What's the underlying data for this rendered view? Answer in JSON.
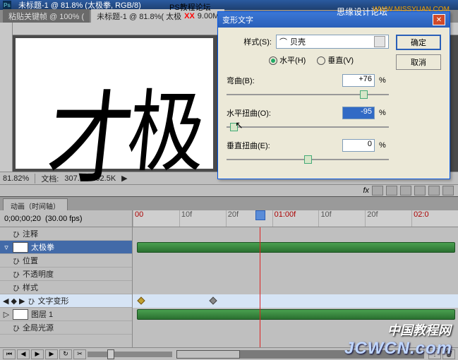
{
  "titlebar": {
    "doc": "未标题-1 @ 81.8% (太极拳, RGB/8)"
  },
  "tabs": {
    "t1": "粘贴关键帧 @ 100% (",
    "t2": "未标题-1 @ 81.8%( 太极",
    "t2_suffix": "9.00M"
  },
  "watermark": {
    "line1": "PS教程论坛",
    "xx": "XX",
    "forum": "思缘设计论坛",
    "url": "WWW.MISSYUAN.COM",
    "cn": "中国教程网",
    "jcw": "JCWCN.com"
  },
  "canvas": {
    "char1": "才",
    "char2": "极"
  },
  "status": {
    "zoom": "81.82%",
    "doc_label": "文档:",
    "doc_size": "307.6K/102.5K"
  },
  "dialog": {
    "title": "变形文字",
    "style_label": "样式(S):",
    "style_value": "贝壳",
    "style_icon": "⌒",
    "horiz": "水平(H)",
    "vert": "垂直(V)",
    "bend_label": "弯曲(B):",
    "bend_value": "+76",
    "hdist_label": "水平扭曲(O):",
    "hdist_value": "-95",
    "vdist_label": "垂直扭曲(E):",
    "vdist_value": "0",
    "pct": "%",
    "ok": "确定",
    "cancel": "取消"
  },
  "timeline": {
    "tab": "动画（时间轴）",
    "time": "0;00;00;20",
    "fps": "(30.00 fps)",
    "ticks": [
      "00",
      "10f",
      "20f",
      "01:00f",
      "10f",
      "20f",
      "02:0"
    ],
    "rows": {
      "comments": "注释",
      "layer": "太极拳",
      "position": "位置",
      "opacity": "不透明度",
      "style": "样式",
      "textwarp": "文字变形",
      "layer1": "图层 1",
      "globallight": "全局光源"
    }
  }
}
